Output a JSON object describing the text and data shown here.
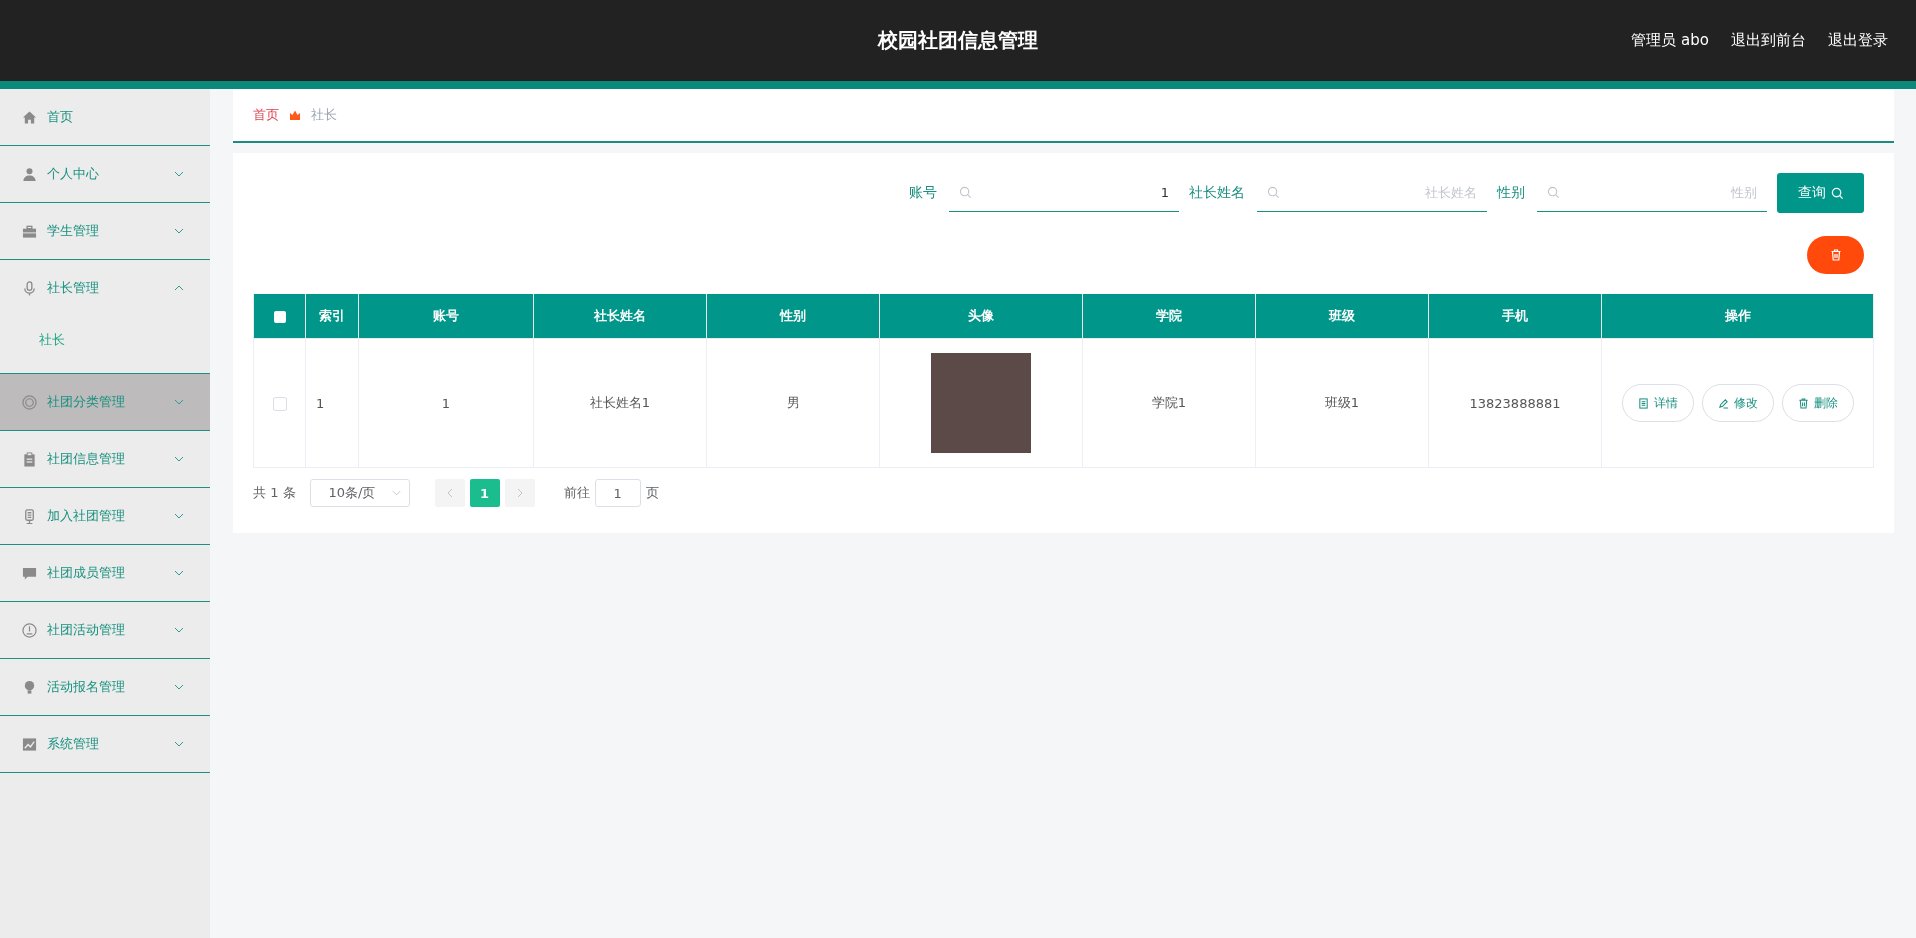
{
  "header": {
    "title": "校园社团信息管理",
    "user": "管理员 abo",
    "links": [
      "退出到前台",
      "退出登录"
    ]
  },
  "sidebar": {
    "items": [
      {
        "kind": "link",
        "label": "首页",
        "hovered": false
      },
      {
        "kind": "menu",
        "label": "个人中心",
        "expanded": false,
        "hovered": false
      },
      {
        "kind": "menu",
        "label": "学生管理",
        "expanded": false,
        "hovered": false
      },
      {
        "kind": "menu",
        "label": "社长管理",
        "expanded": true,
        "hovered": false,
        "children": [
          {
            "label": "社长",
            "selected": true
          }
        ]
      },
      {
        "kind": "menu",
        "label": "社团分类管理",
        "expanded": false,
        "hovered": true
      },
      {
        "kind": "menu",
        "label": "社团信息管理",
        "expanded": false,
        "hovered": false
      },
      {
        "kind": "menu",
        "label": "加入社团管理",
        "expanded": false,
        "hovered": false
      },
      {
        "kind": "menu",
        "label": "社团成员管理",
        "expanded": false,
        "hovered": false
      },
      {
        "kind": "menu",
        "label": "社团活动管理",
        "expanded": false,
        "hovered": false
      },
      {
        "kind": "menu",
        "label": "活动报名管理",
        "expanded": false,
        "hovered": false
      },
      {
        "kind": "menu",
        "label": "系统管理",
        "expanded": false,
        "hovered": false
      }
    ]
  },
  "breadcrumb": [
    "首页",
    "社长"
  ],
  "search": {
    "fields": [
      {
        "label": "账号",
        "value": "1"
      },
      {
        "label": "社长姓名",
        "placeholder": "社长姓名"
      },
      {
        "label": "性别",
        "placeholder": "性别"
      }
    ],
    "button": "查询"
  },
  "table": {
    "all_selected": false,
    "columns": [
      "索引",
      "账号",
      "社长姓名",
      "性别",
      "头像",
      "学院",
      "班级",
      "手机",
      "操作"
    ],
    "rows": [
      {
        "selected": false,
        "cells": [
          "1",
          "1",
          "社长姓名1",
          "男",
          null,
          "学院1",
          "班级1",
          "13823888881"
        ],
        "actions": [
          "详情",
          "修改",
          "删除"
        ]
      }
    ]
  },
  "pagination": {
    "total": "共 1 条",
    "page_size": "10条/页",
    "pages": [
      {
        "label": "1",
        "selected": true
      }
    ],
    "goto_label": "前往",
    "goto_value": "1",
    "goto_suffix": "页"
  }
}
